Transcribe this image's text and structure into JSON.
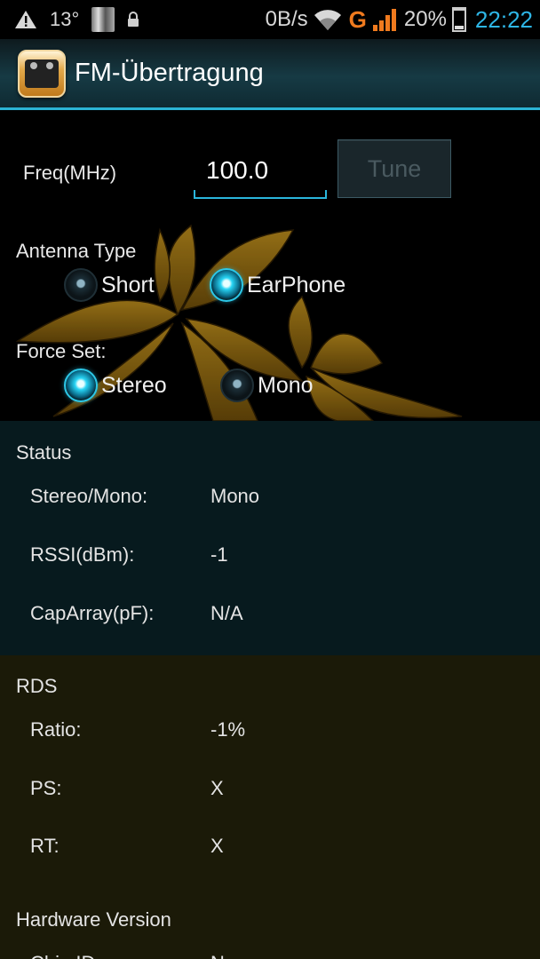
{
  "status_bar": {
    "temperature": "13°",
    "data_rate": "0B/s",
    "network_type": "G",
    "battery": "20%",
    "time": "22:22",
    "icons": [
      "warning-icon",
      "sim-icon",
      "lock-icon",
      "wifi-icon",
      "signal-icon",
      "battery-icon"
    ]
  },
  "action_bar": {
    "title": "FM-Übertragung",
    "icon": "radio-app-icon"
  },
  "form": {
    "freq_label": "Freq(MHz)",
    "freq_value": "100.0",
    "tune_label": "Tune",
    "antenna_label": "Antenna Type",
    "antenna_options": [
      {
        "label": "Short",
        "selected": false
      },
      {
        "label": "EarPhone",
        "selected": true
      }
    ],
    "force_label": "Force Set:",
    "force_options": [
      {
        "label": "Stereo",
        "selected": true
      },
      {
        "label": "Mono",
        "selected": false
      }
    ]
  },
  "status": {
    "title": "Status",
    "rows": [
      {
        "key": "Stereo/Mono:",
        "value": "Mono"
      },
      {
        "key": "RSSI(dBm):",
        "value": "-1"
      },
      {
        "key": "CapArray(pF):",
        "value": "N/A"
      }
    ]
  },
  "rds": {
    "title": "RDS",
    "rows": [
      {
        "key": "Ratio:",
        "value": "-1%"
      },
      {
        "key": "PS:",
        "value": "X"
      },
      {
        "key": "RT:",
        "value": "X"
      }
    ]
  },
  "hardware": {
    "title": "Hardware Version",
    "rows": [
      {
        "key": "Chip ID",
        "value": "None"
      }
    ]
  },
  "colors": {
    "accent": "#2bb3d4",
    "network_g": "#f07a1e",
    "clock": "#2eb6e6",
    "status_bg": "#071a1e",
    "rds_bg": "#1b1a08"
  }
}
